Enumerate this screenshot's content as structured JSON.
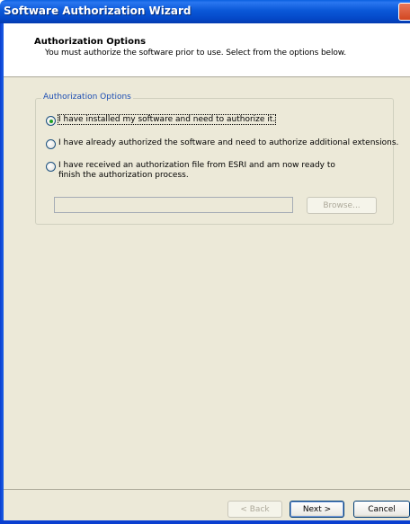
{
  "window": {
    "title": "Software Authorization Wizard"
  },
  "header": {
    "title": "Authorization Options",
    "subtitle": "You must authorize the software prior to use. Select from the options below."
  },
  "group": {
    "legend": "Authorization Options",
    "options": [
      {
        "label": "I have installed my software and need to authorize it.",
        "selected": true
      },
      {
        "label": "I have already authorized the software and need to authorize additional extensions.",
        "selected": false
      },
      {
        "label": "I have received an authorization file from ESRI and am now ready to finish the authorization process.",
        "selected": false
      }
    ],
    "file_path_value": "",
    "browse_label": "Browse..."
  },
  "footer": {
    "back_label": "< Back",
    "next_label": "Next >",
    "cancel_label": "Cancel"
  },
  "colors": {
    "titlebar": "#0a58d8",
    "dialog_bg": "#ece9d8",
    "legend_text": "#1b4db3",
    "radio_dot": "#21a121"
  }
}
